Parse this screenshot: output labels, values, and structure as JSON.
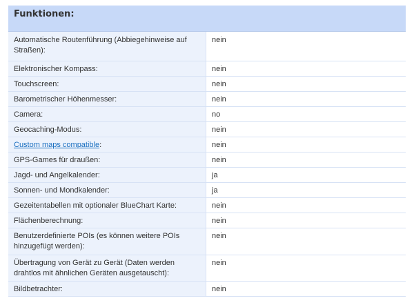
{
  "section": {
    "title": "Funktionen:"
  },
  "rows": [
    {
      "label": "Automatische Routenführung (Abbiegehinweise auf Straßen):",
      "value": "nein"
    },
    {
      "label": "Elektronischer Kompass:",
      "value": "nein"
    },
    {
      "label": "Touchscreen:",
      "value": "nein"
    },
    {
      "label": "Barometrischer Höhenmesser:",
      "value": "nein"
    },
    {
      "label": "Camera:",
      "value": "no"
    },
    {
      "label": "Geocaching-Modus:",
      "value": "nein"
    },
    {
      "label_link": "Custom maps compatible",
      "label_suffix": ":",
      "value": "nein"
    },
    {
      "label": "GPS-Games für draußen:",
      "value": "nein"
    },
    {
      "label": "Jagd- und Angelkalender:",
      "value": "ja"
    },
    {
      "label": "Sonnen- und Mondkalender:",
      "value": "ja"
    },
    {
      "label": "Gezeitentabellen mit optionaler BlueChart Karte:",
      "value": "nein"
    },
    {
      "label": "Flächenberechnung:",
      "value": "nein"
    },
    {
      "label": "Benutzerdefinierte POIs (es können weitere POIs hinzugefügt werden):",
      "value": "nein"
    },
    {
      "label": "Übertragung von Gerät zu Gerät (Daten werden drahtlos mit ähnlichen Geräten ausgetauscht):",
      "value": "nein"
    },
    {
      "label": "Bildbetrachter:",
      "value": "nein"
    }
  ]
}
